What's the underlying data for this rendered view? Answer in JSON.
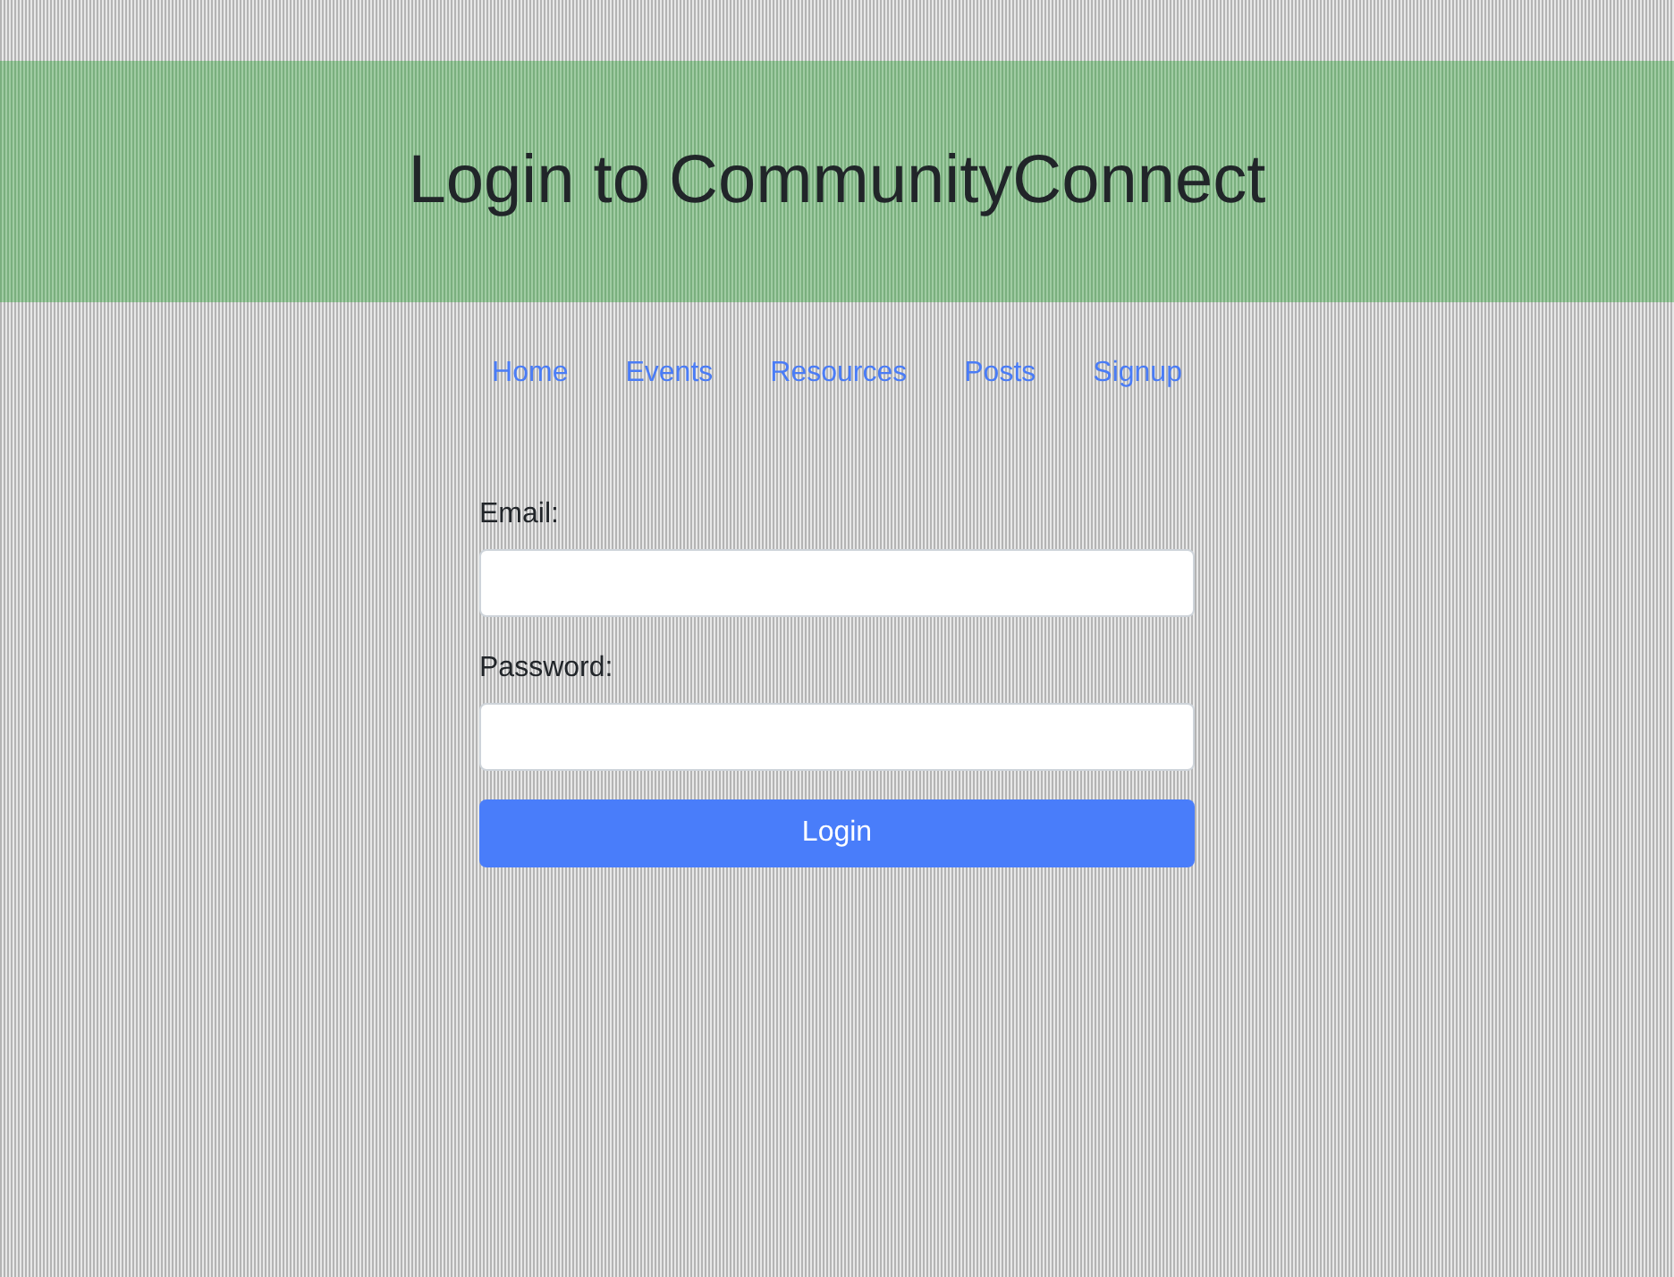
{
  "header": {
    "title": "Login to CommunityConnect"
  },
  "nav": [
    {
      "label": "Home"
    },
    {
      "label": "Events"
    },
    {
      "label": "Resources"
    },
    {
      "label": "Posts"
    },
    {
      "label": "Signup"
    }
  ],
  "form": {
    "fields": [
      {
        "label": "Email:"
      },
      {
        "label": "Password:"
      }
    ],
    "submit": "Login"
  }
}
